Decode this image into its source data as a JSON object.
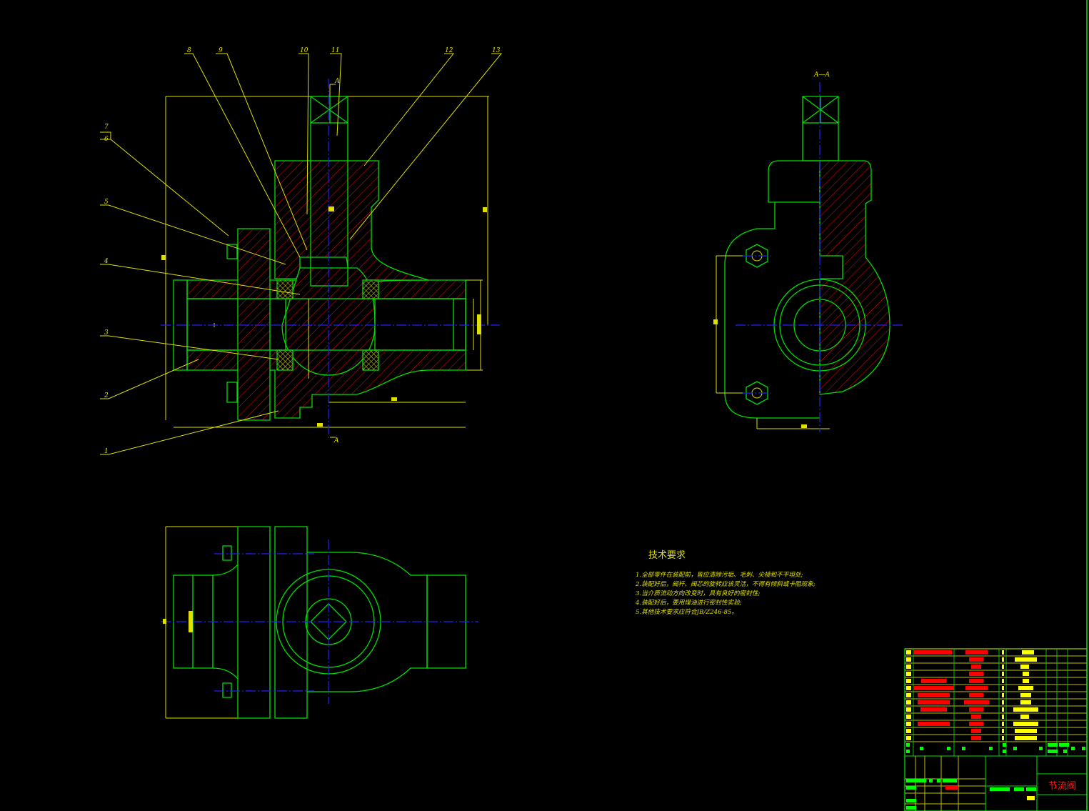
{
  "drawing": {
    "part_labels": [
      "1",
      "2",
      "3",
      "4",
      "5",
      "6",
      "7",
      "8",
      "9",
      "10",
      "11",
      "12",
      "13"
    ],
    "section_mark": "A",
    "section_title": "A—A",
    "tech_requirements": {
      "title": "技术要求",
      "items": [
        "1.全部零件在装配前，皆应清除污垢、毛刺、尖棱和不平坦处;",
        "2.装配好后，阀杆、阀芯的旋转应该灵活，不得有倾斜或卡阻现象;",
        "3.当介质流动方向改变时，具有良好的密封性;",
        "4.装配好后，要用煤油进行密封性实验;",
        "5.其他技术要求应符合JB/Z246-85。"
      ]
    },
    "title_block": {
      "drawing_name": "节流阀"
    },
    "colors": {
      "outline": "#00e000",
      "dimension": "#e0e000",
      "hatch": "#ff2020",
      "centerline": "#2020ff"
    }
  }
}
